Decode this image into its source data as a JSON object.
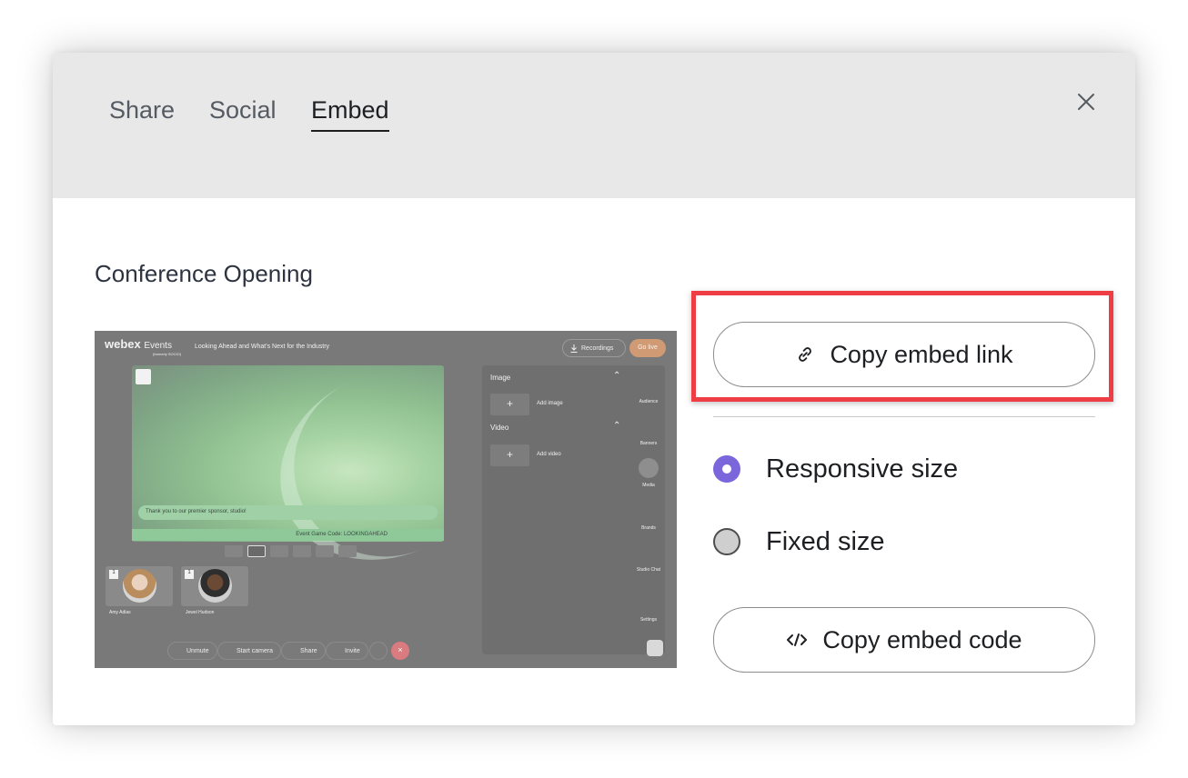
{
  "tabs": [
    {
      "label": "Share"
    },
    {
      "label": "Social"
    },
    {
      "label": "Embed"
    }
  ],
  "active_tab": "Embed",
  "event_title": "Conference Opening",
  "preview": {
    "brand": "webex",
    "brand_suffix": "Events",
    "brand_sub": "(formerly SOCIO)",
    "event_name": "Looking Ahead and What's Next for the Industry",
    "recordings_label": "Recordings",
    "go_live_label": "Go live",
    "sponsor_message": "Thank you to our premier sponsor, studio!",
    "game_code": "Event Game Code: LOOKINGAHEAD",
    "panel": {
      "image_label": "Image",
      "add_image": "Add image",
      "video_label": "Video",
      "add_video": "Add video"
    },
    "side_nav": [
      "Audience",
      "Banners",
      "Media",
      "Brands",
      "Studio Chat",
      "Settings"
    ],
    "participants": [
      {
        "name": "Amy Adlas",
        "badge": "1"
      },
      {
        "name": "Jewel Hudson",
        "badge": "1"
      }
    ],
    "controls": [
      "Unmute",
      "Start camera",
      "Share",
      "Invite"
    ]
  },
  "actions": {
    "copy_link_label": "Copy embed link",
    "copy_code_label": "Copy embed code"
  },
  "size_options": [
    {
      "label": "Responsive size",
      "selected": true
    },
    {
      "label": "Fixed size",
      "selected": false
    }
  ],
  "colors": {
    "accent": "#7c66dc",
    "highlight": "#ef3d45",
    "header_bg": "#e8e8e8"
  }
}
